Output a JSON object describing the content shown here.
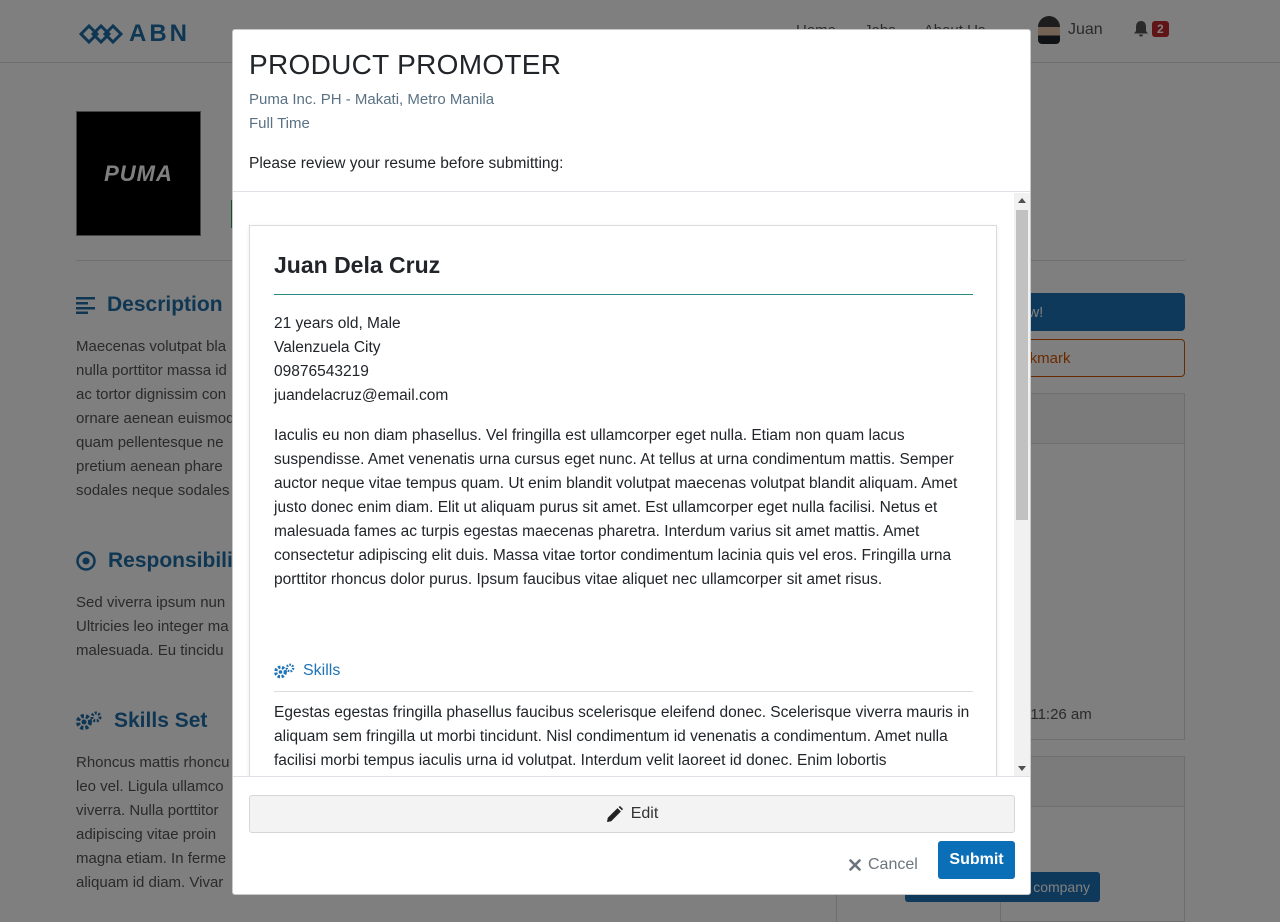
{
  "navbar": {
    "logo_text": "ABN",
    "links": [
      "Home",
      "Jobs",
      "About Us"
    ],
    "user_name": "Juan",
    "notification_count": "2"
  },
  "company": {
    "logo_text": "PUMA"
  },
  "sections": {
    "description_title": "Description",
    "description_lines": [
      "Maecenas volutpat bla",
      "nulla porttitor massa id",
      "ac tortor dignissim con",
      "ornare aenean euismod",
      "quam pellentesque ne",
      "pretium aenean phare",
      "sodales neque sodales"
    ],
    "responsibilities_title": "Responsibilities",
    "responsibilities_lines": [
      "Sed viverra ipsum nun",
      "Ultricies leo integer ma",
      "malesuada. Eu tincidu"
    ],
    "skills_title": "Skills Set",
    "skills_lines": [
      "Rhoncus mattis rhoncu",
      "leo vel. Ligula ullamco",
      "viverra. Nulla porttitor",
      "adipiscing vitae proin",
      "magna etiam. In ferme",
      "aliquam id diam. Vivar"
    ]
  },
  "sidebar": {
    "apply_label": "ow!",
    "bookmark_label": "ookmark",
    "posted_time": "; 11:26 am",
    "company_button": "company"
  },
  "modal": {
    "title": "PRODUCT PROMOTER",
    "company_location": "Puma Inc. PH - Makati, Metro Manila",
    "job_type": "Full Time",
    "review_note": "Please review your resume before submitting:",
    "resume": {
      "name": "Juan Dela Cruz",
      "age_gender": "21 years old, Male",
      "city": "Valenzuela City",
      "phone": "09876543219",
      "email": "juandelacruz@email.com",
      "summary": "Iaculis eu non diam phasellus. Vel fringilla est ullamcorper eget nulla. Etiam non quam lacus suspendisse. Amet venenatis urna cursus eget nunc. At tellus at urna condimentum mattis. Semper auctor neque vitae tempus quam. Ut enim blandit volutpat maecenas volutpat blandit aliquam. Amet justo donec enim diam. Elit ut aliquam purus sit amet. Est ullamcorper eget nulla facilisi. Netus et malesuada fames ac turpis egestas maecenas pharetra. Interdum varius sit amet mattis. Amet consectetur adipiscing elit duis. Massa vitae tortor condimentum lacinia quis vel eros. Fringilla urna porttitor rhoncus dolor purus. Ipsum faucibus vitae aliquet nec ullamcorper sit amet risus.",
      "skills_heading": "Skills",
      "skills_text": "Egestas egestas fringilla phasellus faucibus scelerisque eleifend donec. Scelerisque viverra mauris in aliquam sem fringilla ut morbi tincidunt. Nisl condimentum id venenatis a condimentum. Amet nulla facilisi morbi tempus iaculis urna id volutpat. Interdum velit laoreet id donec. Enim lobortis"
    },
    "edit_label": "Edit",
    "cancel_label": "Cancel",
    "submit_label": "Submit"
  },
  "colors": {
    "brand_blue": "#1f6fa8",
    "submit_blue": "#0b6fb8",
    "bookmark_orange": "#d35400",
    "badge_red": "#c0282d",
    "rule_teal": "#2a8a86"
  }
}
